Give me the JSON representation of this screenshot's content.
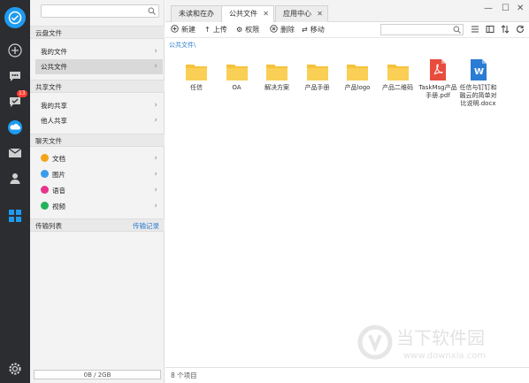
{
  "rail": {
    "badge_count": "13"
  },
  "sidebar": {
    "search_placeholder": "",
    "sections": {
      "cloud": {
        "title": "云盘文件",
        "items": [
          "我的文件",
          "公共文件"
        ]
      },
      "shared": {
        "title": "共享文件",
        "items": [
          "我的共享",
          "他人共享"
        ]
      },
      "chat": {
        "title": "聊天文件",
        "items": [
          "文档",
          "图片",
          "语音",
          "视频"
        ]
      },
      "transfer": {
        "title": "传输列表",
        "link": "传输记录"
      }
    },
    "storage": "0B / 2GB",
    "storage_used_fraction": 0.0
  },
  "tabs": [
    {
      "label": "未读和在办"
    },
    {
      "label": "公共文件"
    },
    {
      "label": "应用中心"
    }
  ],
  "toolbar": {
    "new_label": "新建",
    "upload_label": "上传",
    "permission_label": "权限",
    "delete_label": "删除",
    "move_label": "移动",
    "search_placeholder": ""
  },
  "breadcrumb": "公共文件\\",
  "files": [
    {
      "name": "任信",
      "type": "folder"
    },
    {
      "name": "OA",
      "type": "folder"
    },
    {
      "name": "解决方案",
      "type": "folder"
    },
    {
      "name": "产品手册",
      "type": "folder"
    },
    {
      "name": "产品logo",
      "type": "folder"
    },
    {
      "name": "产品二维码",
      "type": "folder"
    },
    {
      "name": "TaskMsg产品手册.pdf",
      "type": "pdf"
    },
    {
      "name": "任信与钉钉和融云的简单对比说明.docx",
      "type": "docx"
    }
  ],
  "status": "8 个项目",
  "watermark": {
    "title": "当下软件园",
    "url": "www.downxia.com"
  },
  "colors": {
    "accent": "#1e9bf0",
    "folder": "#f7c23c",
    "pdf": "#e84c3d",
    "docx": "#2b7cd3"
  }
}
